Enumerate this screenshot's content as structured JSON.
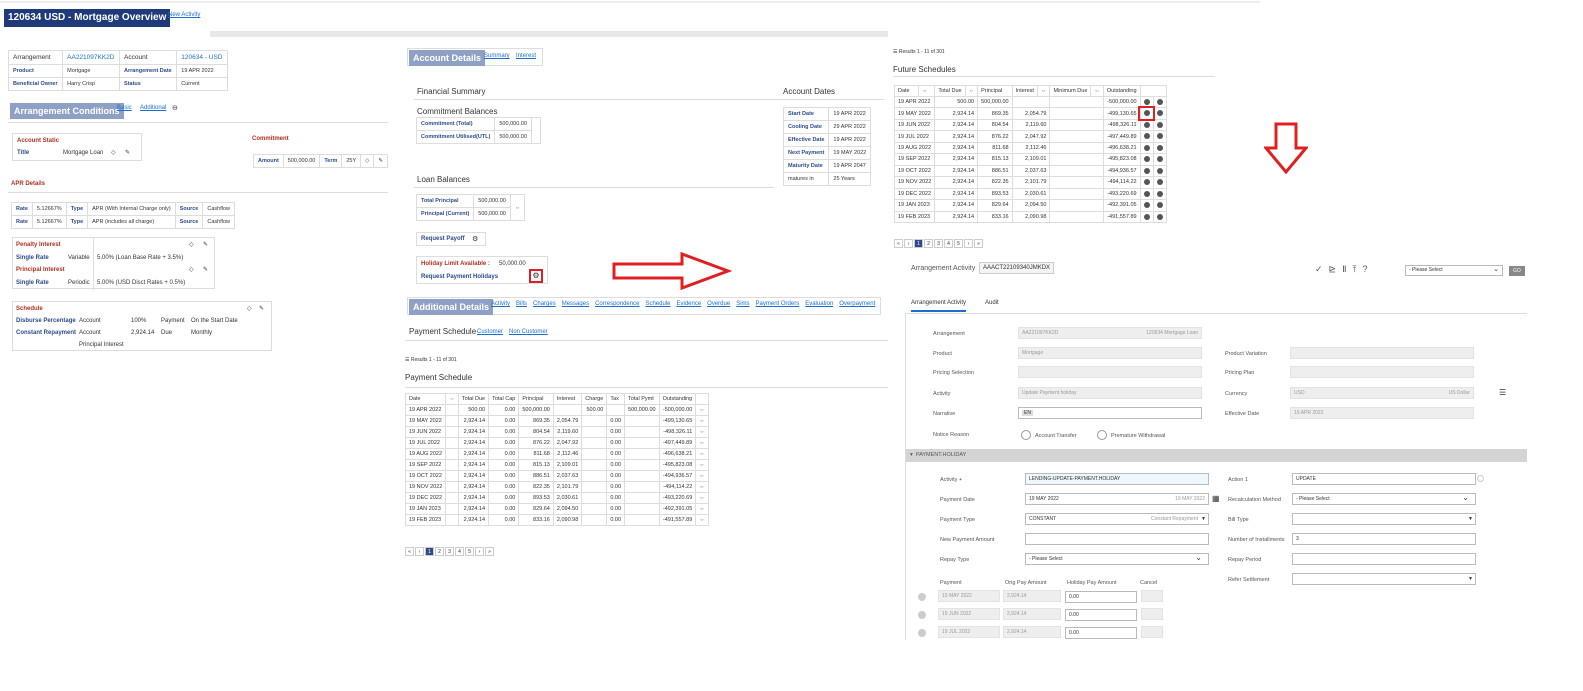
{
  "title": "120634 USD - Mortgage Overview",
  "new_activity": "New Activity",
  "arrangement": {
    "arr_label": "Arrangement",
    "arr_value": "AA221097KK2D",
    "acc_label": "Account",
    "acc_value": "120634 - USD",
    "product_label": "Product",
    "product_value": "Mortgage",
    "arrdate_label": "Arrangement Date",
    "arrdate_value": "19 APR 2022",
    "owner_label": "Beneficial Owner",
    "owner_value": "Harry Crisp",
    "status_label": "Status",
    "status_value": "Current"
  },
  "conditions": {
    "title": "Arrangement Conditions",
    "tab_basic": "Basic",
    "tab_additional": "Additional",
    "acc_static": "Account Static",
    "title_label": "Title",
    "title_value": "Mortgage Loan",
    "commitment": "Commitment",
    "amount_label": "Amount",
    "amount_value": "500,000.00",
    "term_label": "Term",
    "term_value": "25Y"
  },
  "apr": {
    "title": "APR Details",
    "rows": [
      {
        "rate_label": "Rate",
        "rate": "5.12667%",
        "type_label": "Type",
        "type": "APR (With Internal Charge only)",
        "source_label": "Source",
        "source": "Cashflow"
      },
      {
        "rate_label": "Rate",
        "rate": "5.12667%",
        "type_label": "Type",
        "type": "APR (includes all charge)",
        "source_label": "Source",
        "source": "Cashflow"
      }
    ]
  },
  "interest": {
    "penalty": "Penalty Interest",
    "single1": "Single Rate",
    "variable": "Variable",
    "var_rate": "5.00% (Loan Base Rate + 3.5%)",
    "principal": "Principal Interest",
    "single2": "Single Rate",
    "periodic": "Periodic",
    "per_rate": "5.00% (USD Disct Rates + 0.5%)"
  },
  "schedule": {
    "title": "Schedule",
    "disburse": "Disburse Percentage",
    "constant": "Constant Repayment",
    "account1": "Account",
    "account2": "Account",
    "principal_int": "Principal Interest",
    "pct": "100%",
    "amt": "2,924.14",
    "payment": "Payment",
    "due": "Due",
    "start": "On the Start Date",
    "monthly": "Monthly"
  },
  "account_details": {
    "title": "Account Details",
    "tab_summary": "Summary",
    "tab_interest": "Interest",
    "financial_summary": "Financial Summary",
    "commitment_balances": "Commitment Balances",
    "ct_label": "Commitment (Total)",
    "ct_value": "500,000.00",
    "cu_label": "Commitment Utilised(UTL)",
    "cu_value": "500,000.00",
    "loan_balances": "Loan Balances",
    "tp_label": "Total Principal",
    "tp_value": "500,000.00",
    "pc_label": "Principal (Current)",
    "pc_value": "500,000.00",
    "request_payoff": "Request Payoff",
    "holiday_label": "Holiday Limit Available :",
    "holiday_value": "50,000.00",
    "request_holidays": "Request Payment Holidays"
  },
  "account_dates": {
    "title": "Account Dates",
    "rows": [
      [
        "Start Date",
        "19 APR 2022"
      ],
      [
        "Cooling Date",
        "29 APR 2022"
      ],
      [
        "Effective Date",
        "19 APR 2022"
      ],
      [
        "Next Payment",
        "19 MAY 2022"
      ],
      [
        "Maturity Date",
        "19 APR 2047"
      ],
      [
        "matures in",
        "25 Years"
      ]
    ]
  },
  "additional": {
    "title": "Additional Details",
    "tabs": [
      "Activity",
      "Bills",
      "Charges",
      "Messages",
      "Correspondence",
      "Schedule",
      "Evidence",
      "Overdue",
      "Sims",
      "Payment Orders",
      "Evaluation",
      "Overpayment"
    ]
  },
  "payment_schedule": {
    "title": "Payment Schedule",
    "tab_customer": "Customer",
    "tab_noncustomer": "Non Customer",
    "results": "Results 1 - 11 of 301",
    "subtitle": "Payment Schedule",
    "headers": [
      "Date",
      "Total Due",
      "Total Cap",
      "Principal",
      "Interest",
      "Charge",
      "Tax",
      "Total Pymt",
      "Outstanding"
    ],
    "rows": [
      [
        "19 APR 2022",
        "500.00",
        "0.00",
        "500,000.00",
        "",
        "500.00",
        "",
        "500,000.00",
        "-500,000.00"
      ],
      [
        "19 MAY 2022",
        "2,924.14",
        "0.00",
        "869.35",
        "2,054.79",
        "",
        "0.00",
        "",
        "-499,130.65"
      ],
      [
        "19 JUN 2022",
        "2,924.14",
        "0.00",
        "804.54",
        "2,119.60",
        "",
        "0.00",
        "",
        "-498,326.11"
      ],
      [
        "19 JUL 2022",
        "2,924.14",
        "0.00",
        "876.22",
        "2,047.92",
        "",
        "0.00",
        "",
        "-497,449.89"
      ],
      [
        "19 AUG 2022",
        "2,924.14",
        "0.00",
        "811.68",
        "2,112.46",
        "",
        "0.00",
        "",
        "-496,638.21"
      ],
      [
        "19 SEP 2022",
        "2,924.14",
        "0.00",
        "815.13",
        "2,109.01",
        "",
        "0.00",
        "",
        "-495,823.08"
      ],
      [
        "19 OCT 2022",
        "2,924.14",
        "0.00",
        "886.51",
        "2,037.63",
        "",
        "0.00",
        "",
        "-494,936.57"
      ],
      [
        "19 NOV 2022",
        "2,924.14",
        "0.00",
        "822.35",
        "2,101.79",
        "",
        "0.00",
        "",
        "-494,114.22"
      ],
      [
        "19 DEC 2022",
        "2,924.14",
        "0.00",
        "893.53",
        "2,030.61",
        "",
        "0.00",
        "",
        "-493,220.69"
      ],
      [
        "19 JAN 2023",
        "2,924.14",
        "0.00",
        "829.64",
        "2,094.50",
        "",
        "0.00",
        "",
        "-492,391.05"
      ],
      [
        "19 FEB 2023",
        "2,924.14",
        "0.00",
        "833.16",
        "2,090.98",
        "",
        "0.00",
        "",
        "-491,557.89"
      ]
    ],
    "pages": [
      "«",
      "‹",
      "1",
      "2",
      "3",
      "4",
      "5",
      "›",
      "»"
    ]
  },
  "future": {
    "results": "Results 1 - 11 of 301",
    "title": "Future Schedules",
    "headers": [
      "Date",
      "Total Due",
      "Principal",
      "Interest",
      "Minimum Due",
      "Outstanding"
    ],
    "rows": [
      [
        "19 APR 2022",
        "500.00",
        "500,000.00",
        "",
        "",
        "-500,000.00"
      ],
      [
        "19 MAY 2022",
        "2,924.14",
        "869.35",
        "2,054.79",
        "",
        "-499,130.65"
      ],
      [
        "19 JUN 2022",
        "2,924.14",
        "804.54",
        "2,119.60",
        "",
        "-498,326.11"
      ],
      [
        "19 JUL 2022",
        "2,924.14",
        "876.22",
        "2,047.92",
        "",
        "-497,449.89"
      ],
      [
        "19 AUG 2022",
        "2,924.14",
        "811.68",
        "2,112.46",
        "",
        "-496,638.21"
      ],
      [
        "19 SEP 2022",
        "2,924.14",
        "815.13",
        "2,109.01",
        "",
        "-495,823.08"
      ],
      [
        "19 OCT 2022",
        "2,924.14",
        "886.51",
        "2,037.63",
        "",
        "-494,936.57"
      ],
      [
        "19 NOV 2022",
        "2,924.14",
        "822.35",
        "2,101.79",
        "",
        "-494,114.22"
      ],
      [
        "19 DEC 2022",
        "2,924.14",
        "893.53",
        "2,030.61",
        "",
        "-493,220.69"
      ],
      [
        "19 JAN 2023",
        "2,924.14",
        "829.64",
        "2,094.50",
        "",
        "-492,391.05"
      ],
      [
        "19 FEB 2023",
        "2,924.14",
        "833.16",
        "2,090.98",
        "",
        "-491,557.89"
      ]
    ],
    "pages": [
      "«",
      "‹",
      "1",
      "2",
      "3",
      "4",
      "5",
      "›",
      "»"
    ]
  },
  "activity": {
    "title": "Arrangement Activity",
    "id": "AAACT22109340JMKDX",
    "select": "- Please Select",
    "go": "GO",
    "tab1": "Arrangement Activity",
    "tab2": "Audit",
    "arrangement_label": "Arrangement",
    "arrangement_value": "AA221097KK2D",
    "arrangement_desc": "120634 Mortgage Loan",
    "product_label": "Product",
    "product_value": "Mortgage",
    "product_variation": "Product Variation",
    "pricing_selection": "Pricing Selection",
    "pricing_plan": "Pricing Plan",
    "activity_label": "Activity",
    "activity_value": "Update Payment holiday",
    "currency_label": "Currency",
    "currency_value": "USD",
    "currency_desc": "US Dollar",
    "narrative_label": "Narrative",
    "narrative_lang": "EN",
    "effective_label": "Effective Date",
    "effective_value": "19 APR 2022",
    "notice_label": "Notice Reason",
    "notice_opt1": "Account Transfer",
    "notice_opt2": "Premature Withdrawal",
    "section": "PAYMENT.HOLIDAY",
    "act_label": "Activity +",
    "act_value": "LENDING-UPDATE-PAYMENT.HOLIDAY",
    "action_label": "Action 1",
    "action_value": "UPDATE",
    "paydate_label": "Payment Date",
    "paydate_value": "19 MAY 2022",
    "paydate_hint": "19 MAY 2022",
    "recalc_label": "Recalculation Method",
    "recalc_value": "- Please Select",
    "paytype_label": "Payment Type",
    "paytype_value": "CONSTANT",
    "paytype_desc": "Constant Repayment",
    "billtype_label": "Bill Type",
    "newamt_label": "New Payment Amount",
    "installments_label": "Number of Installments",
    "installments_value": "3",
    "repaytype_label": "Repay Type",
    "repaytype_value": "- Please Select",
    "repayperiod_label": "Repay Period",
    "refer_label": "Refer Settlement",
    "grid_headers": [
      "Payment",
      "Orig Pay Amount",
      "Holiday Pay Amount",
      "Cancel"
    ],
    "grid_rows": [
      [
        "19 MAY 2022",
        "2,924.14",
        "0.00"
      ],
      [
        "19 JUN 2022",
        "2,924.14",
        "0.00"
      ],
      [
        "19 JUL 2022",
        "2,924.14",
        "0.00"
      ]
    ]
  },
  "colors": {
    "header_bg": "#1f3a78",
    "accent_btn": "#8fa0c6",
    "highlight": "#e02020"
  }
}
